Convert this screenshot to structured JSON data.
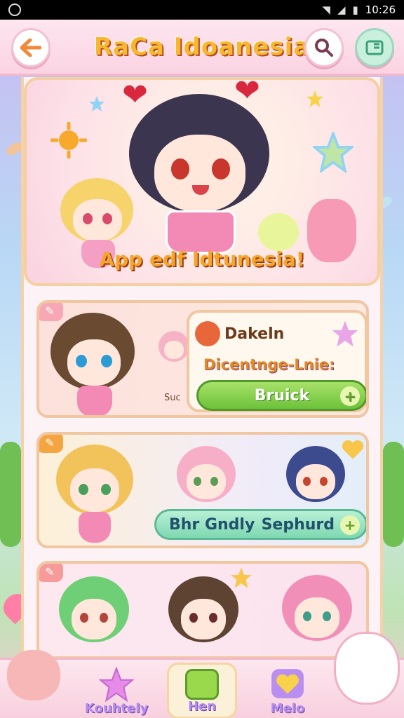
{
  "status_bar": {
    "time": "10:26"
  },
  "header": {
    "title": "RaCa Idoanesia"
  },
  "hero": {
    "caption": "App edf Idtunesia!"
  },
  "card1": {
    "sub_label": "Suc",
    "popup_title": "Dakeln",
    "popup_subtitle": "Dicentnge-Lnie:",
    "button_label": "Bruick"
  },
  "card2": {
    "button_left": "Bhr Gndly",
    "button_right": "Sephurd"
  },
  "tabs": [
    {
      "label": "Kouhtely"
    },
    {
      "label": "Hen"
    },
    {
      "label": "Melo"
    }
  ],
  "colors": {
    "accent_pink": "#f8cfde",
    "title_yellow": "#f7b82c",
    "button_green": "#6dc23a",
    "button_teal": "#7fd8b1"
  }
}
